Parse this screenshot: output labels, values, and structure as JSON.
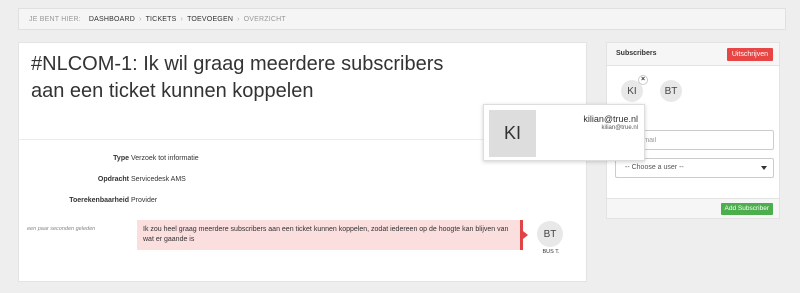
{
  "breadcrumb": {
    "prefix": "JE BENT HIER:",
    "items": [
      "DASHBOARD",
      "TICKETS",
      "TOEVOEGEN",
      "OVERZICHT"
    ]
  },
  "ticket": {
    "title": "#NLCOM-1: Ik wil graag meerdere subscribers aan een ticket kunnen koppelen",
    "fields": [
      {
        "label": "Type",
        "value": "Verzoek tot informatie"
      },
      {
        "label": "Opdracht",
        "value": "Servicedesk AMS"
      },
      {
        "label": "Toerekenbaarheid",
        "value": "Provider"
      }
    ]
  },
  "comment": {
    "time": "een paar seconden geleden",
    "text": "Ik zou heel graag meerdere subscribers aan een ticket kunnen koppelen, zodat iedereen op de hoogte kan blijven van wat er gaande is",
    "author_initials": "BT",
    "author_name": "BUS T.",
    "accent": "#e04444"
  },
  "subscribers": {
    "title": "Subscribers",
    "unsubscribe_label": "Uitschrijven",
    "list": [
      {
        "initials": "KI"
      },
      {
        "initials": "BT"
      }
    ],
    "remove_glyph": "×",
    "email_placeholder": "y email",
    "select_value": "-- Choose a user --",
    "add_label": "Add Subscriber",
    "colors": {
      "danger": "#e84545",
      "success": "#4cae4c"
    }
  },
  "popover": {
    "initials": "KI",
    "name": "kilian@true.nl",
    "email": "kilian@true.nl"
  }
}
